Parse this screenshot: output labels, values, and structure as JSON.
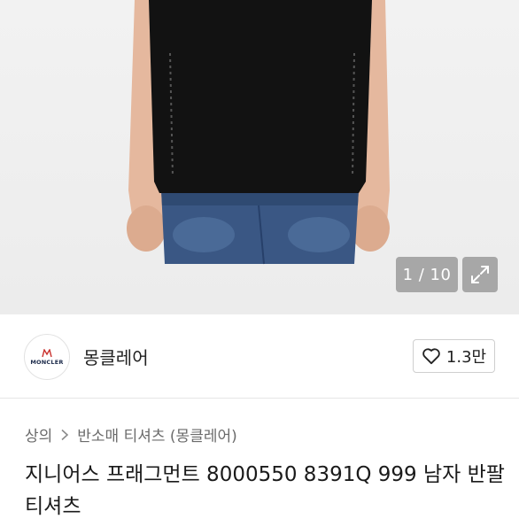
{
  "gallery": {
    "counter": "1 / 10"
  },
  "icons": {
    "expand": "expand-icon",
    "heart": "heart-icon",
    "chevron": "chevron-right-icon"
  },
  "store": {
    "logo_text": "MONCLER",
    "name": "몽클레어",
    "like_count": "1.3만"
  },
  "breadcrumb": {
    "items": [
      "상의",
      "반소매 티셔츠 (몽클레어)"
    ]
  },
  "product": {
    "title": "지니어스 프래그먼트 8000550 8391Q 999 남자 반팔티셔츠"
  },
  "colors": {
    "shirt": "#121212",
    "denim": "#35507a",
    "skin": "#e2b49a",
    "overlay": "#8c8c8c"
  }
}
